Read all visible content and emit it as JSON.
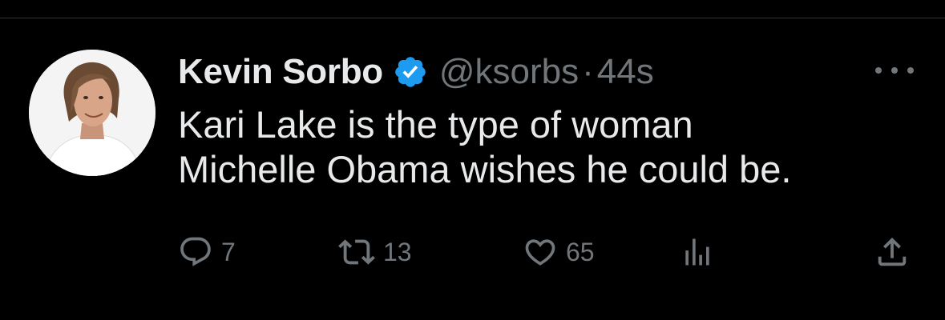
{
  "tweet": {
    "display_name": "Kevin Sorbo",
    "handle": "@ksorbs",
    "separator": "·",
    "time": "44s",
    "text_lines": [
      "Kari Lake is the type of woman",
      "Michelle Obama wishes he could be."
    ],
    "verified": true,
    "verified_color": "#1d9bf0"
  },
  "actions": {
    "reply_count": "7",
    "retweet_count": "13",
    "like_count": "65"
  },
  "icons": {
    "avatar": "avatar",
    "verified": "verified-badge-icon",
    "more": "more-options-icon",
    "reply": "reply-icon",
    "retweet": "retweet-icon",
    "like": "heart-icon",
    "views": "views-icon",
    "share": "share-icon"
  },
  "colors": {
    "background": "#000000",
    "text_primary": "#e7e9ea",
    "text_secondary": "#71767b",
    "divider": "#2f3336"
  }
}
